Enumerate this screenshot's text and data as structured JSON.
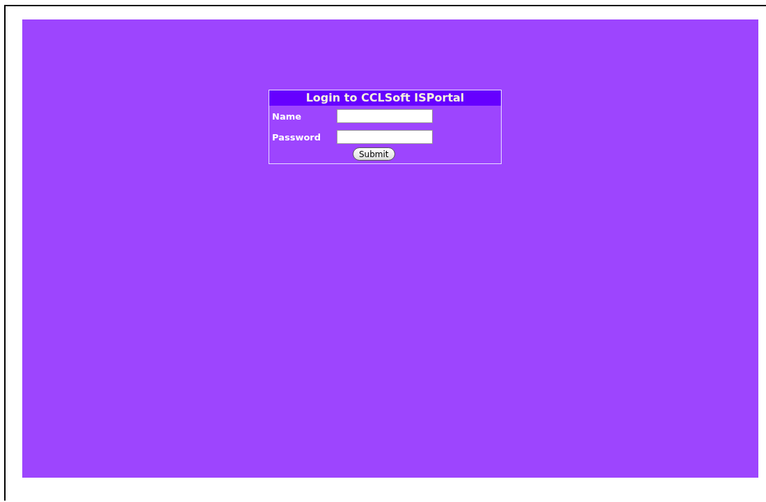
{
  "login_form": {
    "title": "Login to CCLSoft ISPortal",
    "fields": [
      {
        "label": "Name"
      },
      {
        "label": "Password"
      }
    ],
    "submit": "Submit"
  }
}
